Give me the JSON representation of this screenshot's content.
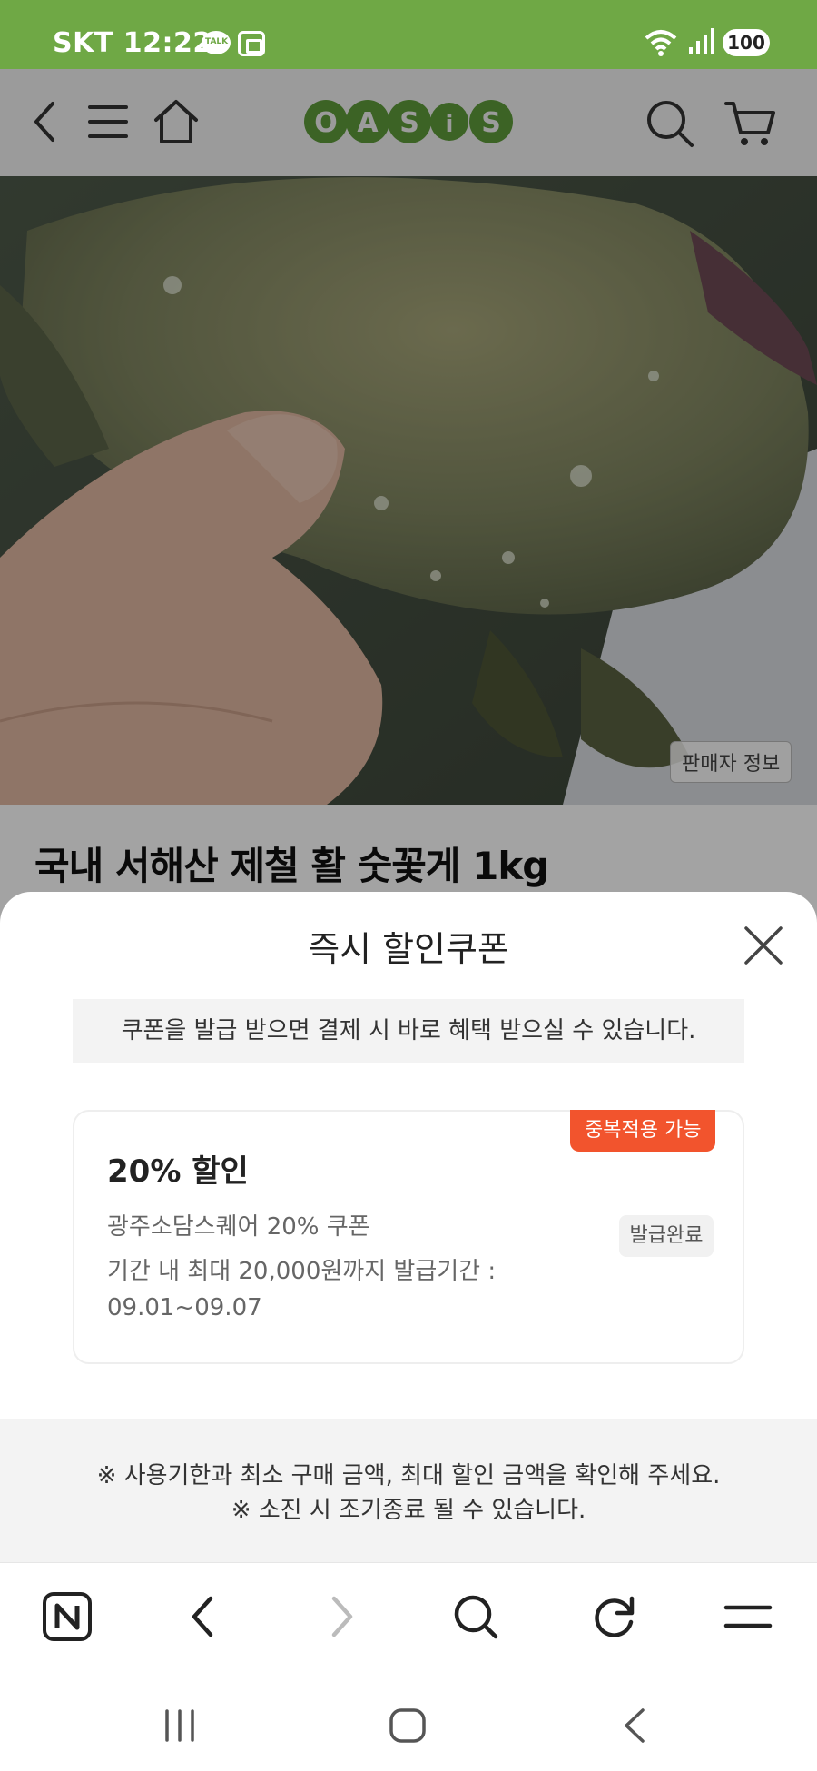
{
  "status_bar": {
    "carrier": "SKT",
    "time": "12:22",
    "talk_badge": "TALK",
    "battery": "100"
  },
  "header": {
    "logo": "OASiS",
    "icons": [
      "back-icon",
      "menu-icon",
      "home-icon",
      "search-icon",
      "cart-icon"
    ]
  },
  "product": {
    "seller_info": "판매자 정보",
    "title": "국내 서해산 제철 활 숫꽃게 1kg"
  },
  "coupon_sheet": {
    "title": "즉시 할인쿠폰",
    "info": "쿠폰을 발급 받으면 결제 시 바로 혜택 받으실 수 있습니다.",
    "coupon": {
      "badge": "중복적용 가능",
      "discount": "20% 할인",
      "name": "광주소담스퀘어 20% 쿠폰",
      "desc_line1": "기간 내 최대 20,000원까지 발급기간 :",
      "desc_line2": "09.01~09.07",
      "status": "발급완료"
    },
    "notice_line1": "※ 사용기한과 최소 구매 금액, 최대 할인 금액을 확인해 주세요.",
    "notice_line2": "※ 소진 시 조기종료 될 수 있습니다."
  },
  "browser_bar": {
    "icons": [
      "naver-icon",
      "back-icon",
      "forward-icon",
      "search-icon",
      "refresh-icon",
      "menu-icon"
    ]
  },
  "system_nav": {
    "icons": [
      "recent-apps-icon",
      "home-icon",
      "back-icon"
    ]
  },
  "colors": {
    "status_green": "#6fa845",
    "logo_green": "#5e9c3a",
    "badge_orange": "#f2542d"
  }
}
